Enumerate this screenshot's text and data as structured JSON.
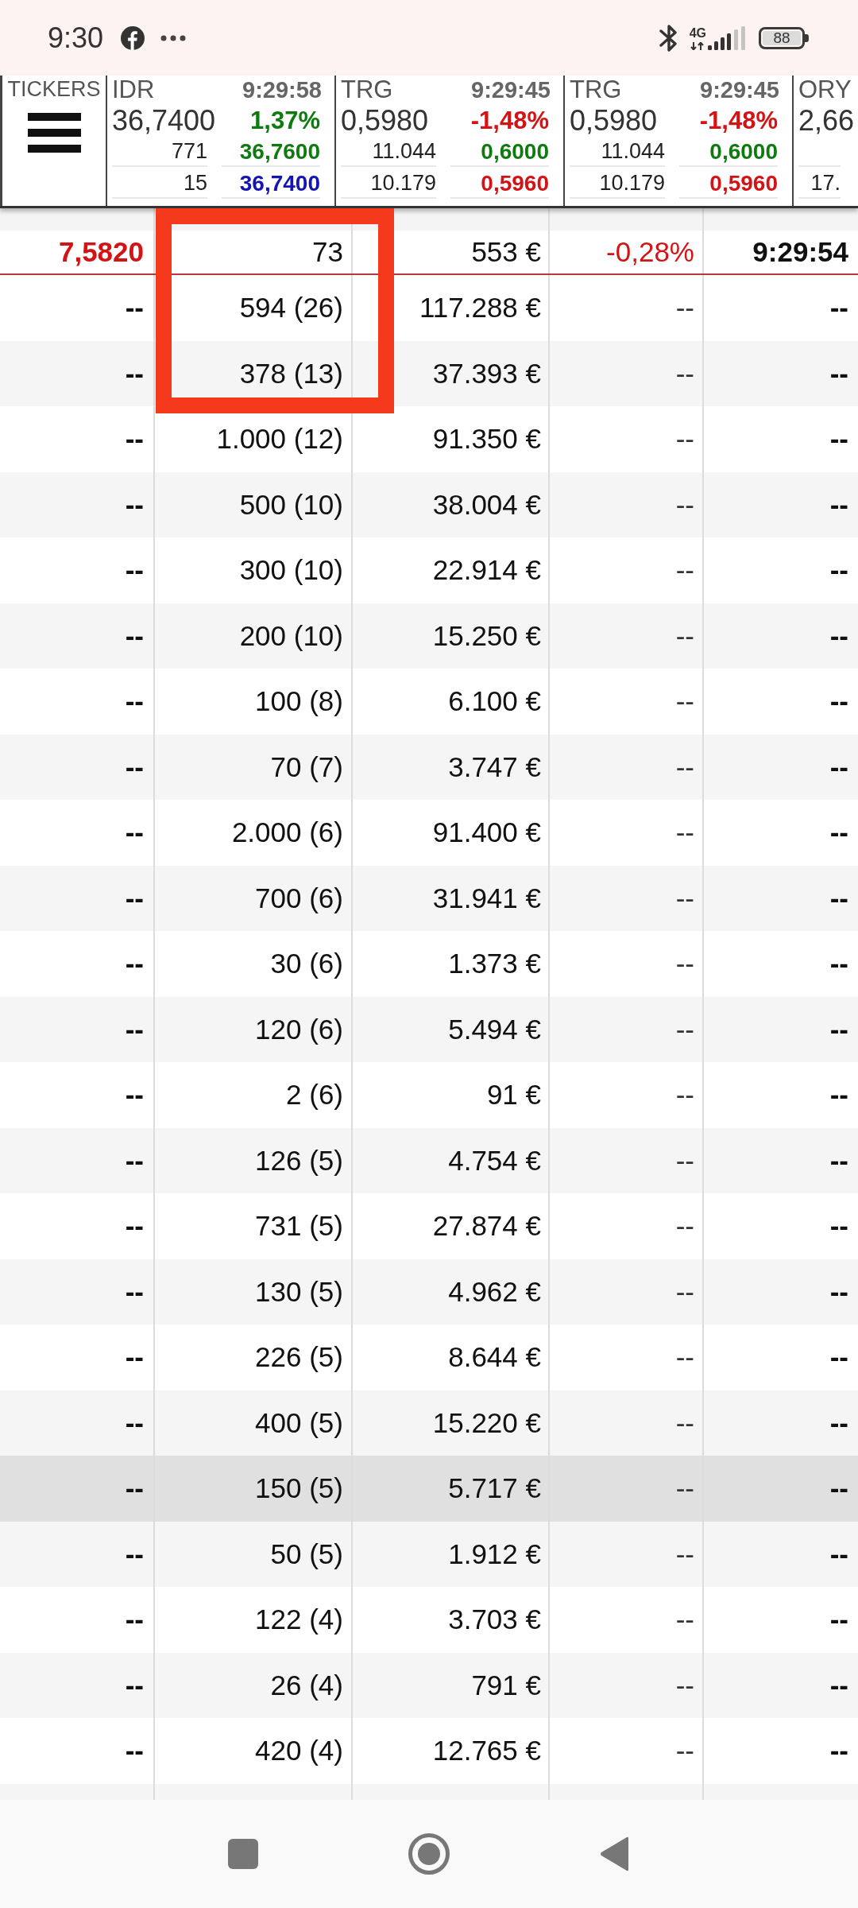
{
  "status_bar": {
    "time": "9:30",
    "network": "4G",
    "battery": "88"
  },
  "tickers_button": {
    "label": "TICKERS"
  },
  "tickers": [
    {
      "symbol": "IDR",
      "time": "9:29:58",
      "price": "36,7400",
      "change": {
        "text": "1,37%",
        "color": "#0f7a0f"
      },
      "bid": {
        "volume": "771",
        "price": {
          "text": "36,7600",
          "color": "#0f7a0f"
        }
      },
      "ask": {
        "volume": "15",
        "price": {
          "text": "36,7400",
          "color": "#1414b4"
        }
      }
    },
    {
      "symbol": "TRG",
      "time": "9:29:45",
      "price": "0,5980",
      "change": {
        "text": "-1,48%",
        "color": "#d41414"
      },
      "bid": {
        "volume": "11.044",
        "price": {
          "text": "0,6000",
          "color": "#0f7a0f"
        }
      },
      "ask": {
        "volume": "10.179",
        "price": {
          "text": "0,5960",
          "color": "#d41414"
        }
      }
    },
    {
      "symbol": "TRG",
      "time": "9:29:45",
      "price": "0,5980",
      "change": {
        "text": "-1,48%",
        "color": "#d41414"
      },
      "bid": {
        "volume": "11.044",
        "price": {
          "text": "0,6000",
          "color": "#0f7a0f"
        }
      },
      "ask": {
        "volume": "10.179",
        "price": {
          "text": "0,5960",
          "color": "#d41414"
        }
      }
    },
    {
      "symbol": "ORY",
      "price": "2,66",
      "ask": {
        "volume": "17."
      }
    }
  ],
  "table": {
    "trades": [
      {
        "cells": [
          "7,5820",
          "73",
          "553 €",
          "-0,28%",
          "9:29:54"
        ],
        "color": "#d41414"
      }
    ],
    "levels": [
      {
        "cells": [
          "--",
          "594 (26)",
          "117.288 €",
          "--",
          "--"
        ],
        "selected": false
      },
      {
        "cells": [
          "--",
          "378 (13)",
          "37.393 €",
          "--",
          "--"
        ],
        "selected": false
      },
      {
        "cells": [
          "--",
          "1.000 (12)",
          "91.350 €",
          "--",
          "--"
        ],
        "selected": false
      },
      {
        "cells": [
          "--",
          "500 (10)",
          "38.004 €",
          "--",
          "--"
        ],
        "selected": false
      },
      {
        "cells": [
          "--",
          "300 (10)",
          "22.914 €",
          "--",
          "--"
        ],
        "selected": false
      },
      {
        "cells": [
          "--",
          "200 (10)",
          "15.250 €",
          "--",
          "--"
        ],
        "selected": false
      },
      {
        "cells": [
          "--",
          "100 (8)",
          "6.100 €",
          "--",
          "--"
        ],
        "selected": false
      },
      {
        "cells": [
          "--",
          "70 (7)",
          "3.747 €",
          "--",
          "--"
        ],
        "selected": false
      },
      {
        "cells": [
          "--",
          "2.000 (6)",
          "91.400 €",
          "--",
          "--"
        ],
        "selected": false
      },
      {
        "cells": [
          "--",
          "700 (6)",
          "31.941 €",
          "--",
          "--"
        ],
        "selected": false
      },
      {
        "cells": [
          "--",
          "30 (6)",
          "1.373 €",
          "--",
          "--"
        ],
        "selected": false
      },
      {
        "cells": [
          "--",
          "120 (6)",
          "5.494 €",
          "--",
          "--"
        ],
        "selected": false
      },
      {
        "cells": [
          "--",
          "2 (6)",
          "91 €",
          "--",
          "--"
        ],
        "selected": false
      },
      {
        "cells": [
          "--",
          "126 (5)",
          "4.754 €",
          "--",
          "--"
        ],
        "selected": false
      },
      {
        "cells": [
          "--",
          "731 (5)",
          "27.874 €",
          "--",
          "--"
        ],
        "selected": false
      },
      {
        "cells": [
          "--",
          "130 (5)",
          "4.962 €",
          "--",
          "--"
        ],
        "selected": false
      },
      {
        "cells": [
          "--",
          "226 (5)",
          "8.644 €",
          "--",
          "--"
        ],
        "selected": false
      },
      {
        "cells": [
          "--",
          "400 (5)",
          "15.220 €",
          "--",
          "--"
        ],
        "selected": false
      },
      {
        "cells": [
          "--",
          "150 (5)",
          "5.717 €",
          "--",
          "--"
        ],
        "selected": true
      },
      {
        "cells": [
          "--",
          "50 (5)",
          "1.912 €",
          "--",
          "--"
        ],
        "selected": false
      },
      {
        "cells": [
          "--",
          "122 (4)",
          "3.703 €",
          "--",
          "--"
        ],
        "selected": false
      },
      {
        "cells": [
          "--",
          "26 (4)",
          "791 €",
          "--",
          "--"
        ],
        "selected": false
      },
      {
        "cells": [
          "--",
          "420 (4)",
          "12.765 €",
          "--",
          "--"
        ],
        "selected": false
      }
    ]
  }
}
